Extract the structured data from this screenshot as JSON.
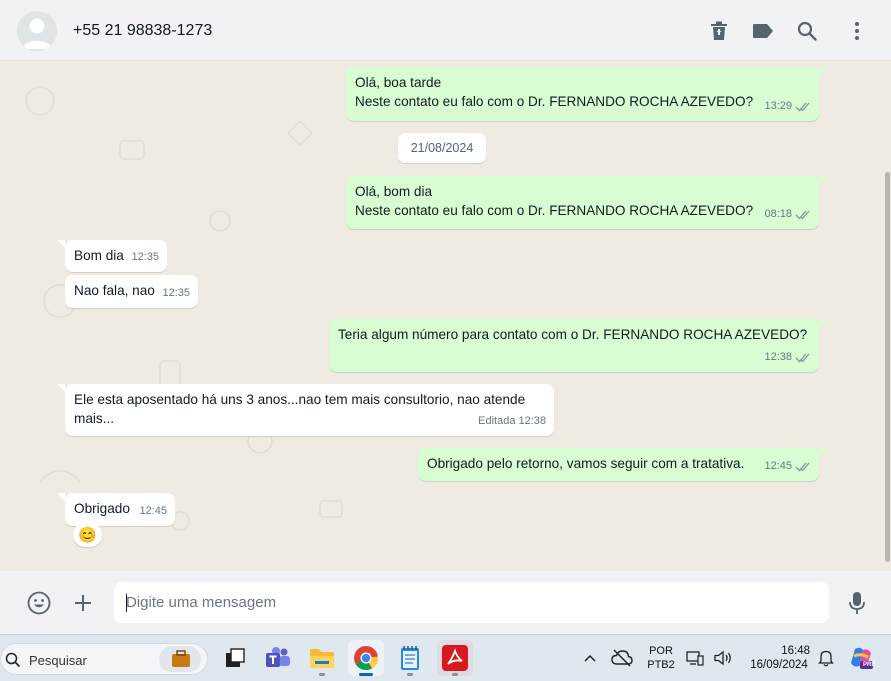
{
  "header": {
    "contact_name": "+55 21 98838-1273",
    "icons": [
      "delete-icon",
      "label-icon",
      "search-icon",
      "menu-icon"
    ]
  },
  "messages": [
    {
      "direction": "out",
      "text_line1": "Olá, boa tarde",
      "text_line2": "Neste contato eu falo com o Dr.  FERNANDO ROCHA AZEVEDO?",
      "time": "13:29",
      "status": "read"
    },
    {
      "date_separator": "21/08/2024"
    },
    {
      "direction": "out",
      "text_line1": "Olá, bom dia",
      "text_line2": "Neste contato eu falo com o Dr.  FERNANDO ROCHA AZEVEDO?",
      "time": "08:18",
      "status": "read"
    },
    {
      "direction": "in",
      "text": "Bom dia",
      "time": "12:35"
    },
    {
      "direction": "in",
      "text": "Nao fala, nao",
      "time": "12:35"
    },
    {
      "direction": "out",
      "text": "Teria algum número para contato com o Dr. FERNANDO ROCHA AZEVEDO?",
      "time": "12:38",
      "status": "read"
    },
    {
      "direction": "in",
      "text_line1": "Ele esta aposentado há uns 3 anos...nao tem mais consultorio, nao atende",
      "text_line2": "mais...",
      "edited_label": "Editada",
      "time": "12:38"
    },
    {
      "direction": "out",
      "text": "Obrigado pelo retorno, vamos seguir com a tratativa.",
      "time": "12:45",
      "status": "read"
    },
    {
      "direction": "in",
      "text": "Obrigado",
      "time": "12:45",
      "reaction": "😊"
    }
  ],
  "composer": {
    "placeholder": "Digite uma mensagem",
    "value": ""
  },
  "taskbar": {
    "search_label": "Pesquisar",
    "language_line1": "POR",
    "language_line2": "PTB2",
    "time": "16:48",
    "date": "16/09/2024",
    "copilot_badge": "PRE"
  },
  "colors": {
    "outgoing_bubble": "#d9fdd3",
    "incoming_bubble": "#ffffff",
    "chat_background": "#efeae2",
    "read_ticks": "#53bdeb"
  }
}
